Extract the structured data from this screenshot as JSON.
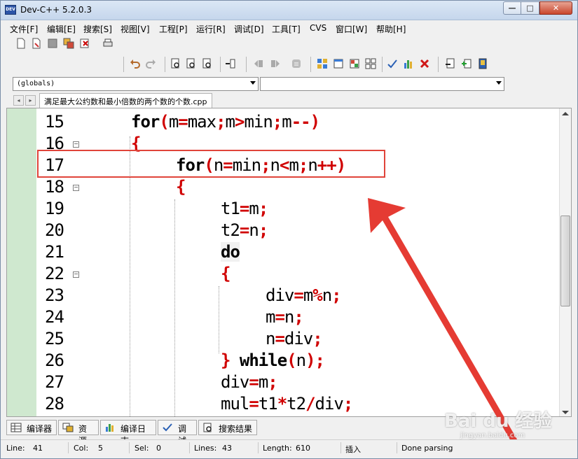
{
  "window": {
    "title": "Dev-C++ 5.2.0.3",
    "app_icon_text": "DEV",
    "minimize_glyph": "—",
    "maximize_glyph": "□",
    "close_glyph": "✕"
  },
  "menubar": {
    "items": [
      "文件[F]",
      "编辑[E]",
      "搜索[S]",
      "视图[V]",
      "工程[P]",
      "运行[R]",
      "调试[D]",
      "工具[T]",
      "CVS",
      "窗口[W]",
      "帮助[H]"
    ]
  },
  "toolbar": {
    "icons": [
      "new-file-icon",
      "open-file-icon",
      "save-icon",
      "save-all-icon",
      "close-file-icon",
      "print-icon",
      "undo-icon",
      "redo-icon",
      "find-icon",
      "replace-icon",
      "find-next-icon",
      "goto-line-icon",
      "bookmark-icon",
      "bookmark-next-icon",
      "bookmark-clear-icon",
      "class-browser-icon",
      "project-icon",
      "new-class-icon",
      "tile-icon",
      "check-syntax-icon",
      "profile-icon",
      "stop-icon",
      "compile-icon",
      "add-file-icon",
      "save-project-icon"
    ]
  },
  "scope_combo": {
    "value": "(globals)"
  },
  "function_combo": {
    "value": ""
  },
  "tabs": {
    "nav_left": "◂",
    "nav_right": "▸",
    "file_tab": "满足最大公约数和最小倍数的两个数的个数.cpp"
  },
  "editor": {
    "line_numbers": [
      "15",
      "16",
      "17",
      "18",
      "19",
      "20",
      "21",
      "22",
      "23",
      "24",
      "25",
      "26",
      "27",
      "28"
    ],
    "fold_marker": "−",
    "code_tokens": {
      "l15": [
        "for",
        "(",
        "m",
        "=",
        "max",
        ";",
        "m",
        ">",
        "min",
        ";",
        "m",
        "--",
        ")"
      ],
      "l16": [
        "{"
      ],
      "l17": [
        "for",
        "(",
        "n",
        "=",
        "min",
        ";",
        "n",
        "<",
        "m",
        ";",
        "n",
        "++",
        ")"
      ],
      "l18": [
        "{"
      ],
      "l19": [
        "t1",
        "=",
        "m",
        ";"
      ],
      "l20": [
        "t2",
        "=",
        "n",
        ";"
      ],
      "l21": [
        "do"
      ],
      "l22": [
        "{"
      ],
      "l23": [
        "div",
        "=",
        "m",
        "%",
        "n",
        ";"
      ],
      "l24": [
        "m",
        "=",
        "n",
        ";"
      ],
      "l25": [
        "n",
        "=",
        "div",
        ";"
      ],
      "l26": [
        "}",
        "while",
        "(",
        "n",
        ")",
        ";"
      ],
      "l27": [
        "div",
        "=",
        "m",
        ";"
      ],
      "l28": [
        "mul",
        "=",
        "t1",
        "*",
        "t2",
        "/",
        "div",
        ";"
      ]
    }
  },
  "bottom_tabs": [
    "编译器",
    "资源",
    "编译日志",
    "调试",
    "搜索结果"
  ],
  "statusbar": {
    "line_label": "Line:",
    "line_value": "41",
    "col_label": "Col:",
    "col_value": "5",
    "sel_label": "Sel:",
    "sel_value": "0",
    "lines_label": "Lines:",
    "lines_value": "43",
    "length_label": "Length:",
    "length_value": "610",
    "mode": "插入",
    "parse_status": "Done parsing"
  },
  "annotation_colors": {
    "box": "#e0443a",
    "arrow": "#e53b33"
  },
  "watermark": {
    "brand": "Bai du 经验",
    "url": "jingyan.baidu.com"
  }
}
